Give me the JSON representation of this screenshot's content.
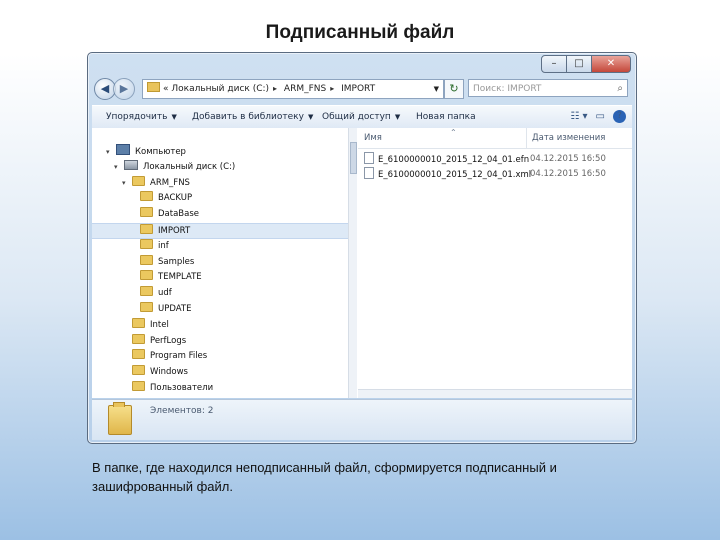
{
  "slide": {
    "title": "Подписанный файл",
    "caption": "В папке, где находился неподписанный файл, сформируется подписанный и зашифрованный файл."
  },
  "window": {
    "caption_buttons": {
      "minimize": "–",
      "maximize": "□",
      "close": "✕"
    },
    "address": {
      "prefix": "«",
      "crumbs": [
        "Локальный диск (C:)",
        "ARM_FNS",
        "IMPORT"
      ]
    },
    "search_placeholder": "Поиск: IMPORT",
    "toolbar": {
      "organize": "Упорядочить",
      "add_to_library": "Добавить в библиотеку",
      "share": "Общий доступ",
      "new_folder": "Новая папка"
    },
    "tree": [
      {
        "label": "Компьютер",
        "type": "computer",
        "level": 0
      },
      {
        "label": "Локальный диск (C:)",
        "type": "drive",
        "level": 1
      },
      {
        "label": "ARM_FNS",
        "type": "folder",
        "level": 2
      },
      {
        "label": "BACKUP",
        "type": "folder",
        "level": 3
      },
      {
        "label": "DataBase",
        "type": "folder",
        "level": 3
      },
      {
        "label": "IMPORT",
        "type": "folder",
        "level": 3,
        "selected": true
      },
      {
        "label": "inf",
        "type": "folder",
        "level": 3
      },
      {
        "label": "Samples",
        "type": "folder",
        "level": 3
      },
      {
        "label": "TEMPLATE",
        "type": "folder",
        "level": 3
      },
      {
        "label": "udf",
        "type": "folder",
        "level": 3
      },
      {
        "label": "UPDATE",
        "type": "folder",
        "level": 3
      },
      {
        "label": "Intel",
        "type": "folder",
        "level": 2
      },
      {
        "label": "PerfLogs",
        "type": "folder",
        "level": 2
      },
      {
        "label": "Program Files",
        "type": "folder",
        "level": 2
      },
      {
        "label": "Windows",
        "type": "folder",
        "level": 2
      },
      {
        "label": "Пользователи",
        "type": "folder",
        "level": 2
      }
    ],
    "columns": {
      "name": "Имя",
      "date": "Дата изменения"
    },
    "files": [
      {
        "name": "E_6100000010_2015_12_04_01.efn",
        "date": "04.12.2015 16:50"
      },
      {
        "name": "E_6100000010_2015_12_04_01.xml",
        "date": "04.12.2015 16:50"
      }
    ],
    "status": "Элементов: 2"
  }
}
